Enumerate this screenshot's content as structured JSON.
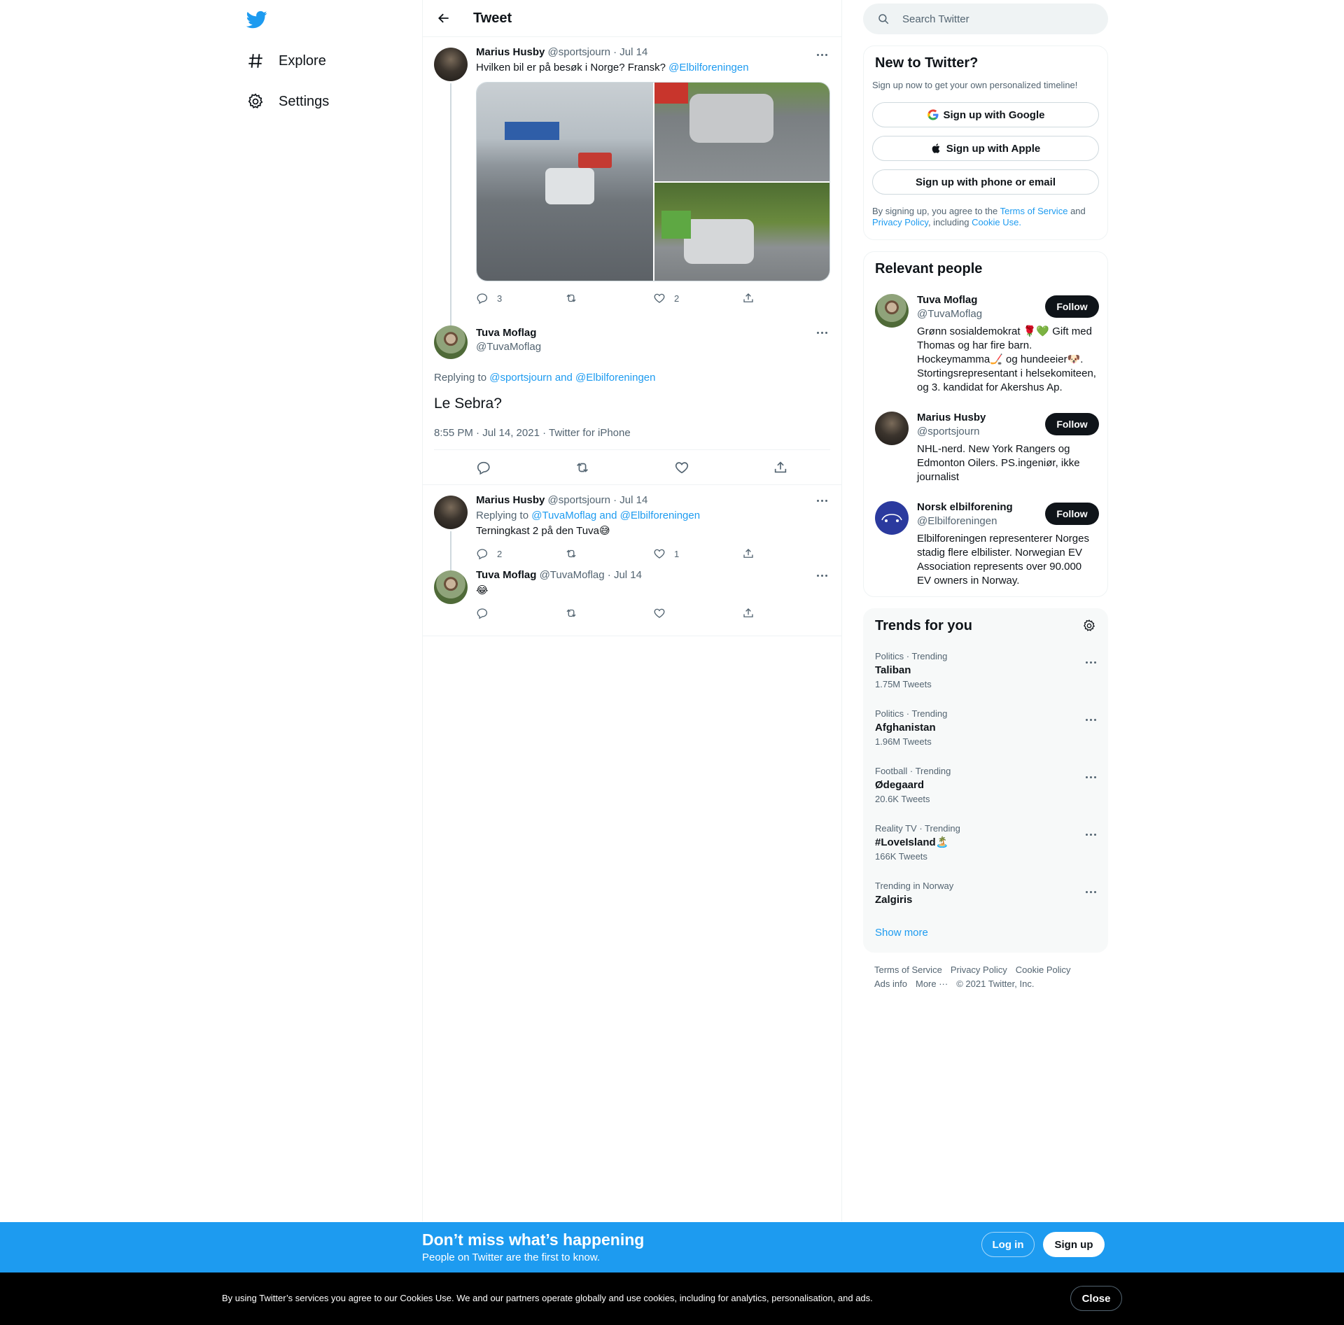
{
  "nav": {
    "items": [
      {
        "label": "Explore",
        "icon": "hashtag-icon"
      },
      {
        "label": "Settings",
        "icon": "gear-icon"
      }
    ]
  },
  "header": {
    "title": "Tweet"
  },
  "thread": {
    "first": {
      "name": "Marius Husby",
      "handle": "@sportsjourn",
      "date": "· Jul 14",
      "text": "Hvilken bil er på besøk i Norge? Fransk?",
      "mention": "@Elbilforeningen",
      "replies": "3",
      "likes": "2"
    },
    "main": {
      "name": "Tuva Moflag",
      "handle": "@TuvaMoflag",
      "replying_prefix": "Replying to",
      "replying_to": "@sportsjourn and @Elbilforeningen",
      "text": "Le Sebra?",
      "timestamp": "8:55 PM · Jul 14, 2021 · Twitter for iPhone"
    },
    "reply1": {
      "name": "Marius Husby",
      "handle": "@sportsjourn",
      "date": "· Jul 14",
      "replying_prefix": "Replying to",
      "replying_to": "@TuvaMoflag and @Elbilforeningen",
      "text": "Terningkast 2 på den Tuva😅",
      "replies": "2",
      "likes": "1"
    },
    "reply2": {
      "name": "Tuva Moflag",
      "handle": "@TuvaMoflag",
      "date": "· Jul 14",
      "text": "😂"
    }
  },
  "search": {
    "placeholder": "Search Twitter"
  },
  "signup": {
    "title": "New to Twitter?",
    "subtitle": "Sign up now to get your own personalized timeline!",
    "google": "Sign up with Google",
    "apple": "Sign up with Apple",
    "phone": "Sign up with phone or email",
    "legal_1": "By signing up, you agree to the",
    "terms": "Terms of Service",
    "legal_2": "and",
    "privacy": "Privacy Policy",
    "legal_3": ", including",
    "cookie": "Cookie Use."
  },
  "people": {
    "title": "Relevant people",
    "follow_label": "Follow",
    "list": [
      {
        "name": "Tuva Moflag",
        "handle": "@TuvaMoflag",
        "bio": "Grønn sosialdemokrat 🌹💚 Gift med Thomas og har fire barn. Hockeymamma🏒 og hundeeier🐶. Stortingsrepresentant i helsekomiteen, og 3. kandidat for Akershus Ap."
      },
      {
        "name": "Marius Husby",
        "handle": "@sportsjourn",
        "bio": "NHL-nerd. New York Rangers og Edmonton Oilers. PS.ingeniør, ikke journalist"
      },
      {
        "name": "Norsk elbilforening",
        "handle": "@Elbilforeningen",
        "bio": "Elbilforeningen representerer Norges stadig flere elbilister. Norwegian EV Association represents over 90.000 EV owners in Norway."
      }
    ]
  },
  "trends": {
    "title": "Trends for you",
    "items": [
      {
        "context": "Politics · Trending",
        "name": "Taliban",
        "count": "1.75M Tweets"
      },
      {
        "context": "Politics · Trending",
        "name": "Afghanistan",
        "count": "1.96M Tweets"
      },
      {
        "context": "Football · Trending",
        "name": "Ødegaard",
        "count": "20.6K Tweets"
      },
      {
        "context": "Reality TV · Trending",
        "name": "#LoveIsland🏝️",
        "count": "166K Tweets"
      },
      {
        "context": "Trending in Norway",
        "name": "Zalgiris",
        "count": ""
      }
    ],
    "show_more": "Show more"
  },
  "footer": {
    "links": [
      "Terms of Service",
      "Privacy Policy",
      "Cookie Policy"
    ],
    "links2": [
      "Ads info",
      "More ···",
      "© 2021 Twitter, Inc."
    ]
  },
  "banner": {
    "title": "Don’t miss what’s happening",
    "subtitle": "People on Twitter are the first to know.",
    "login": "Log in",
    "signup": "Sign up"
  },
  "cookie_bar": {
    "text": "By using Twitter’s services you agree to our Cookies Use. We and our partners operate globally and use cookies, including for analytics, personalisation, and ads.",
    "close": "Close"
  },
  "colors": {
    "accent": "#1d9bf0",
    "text": "#0f1419",
    "muted": "#536471",
    "border": "#eff3f4"
  }
}
